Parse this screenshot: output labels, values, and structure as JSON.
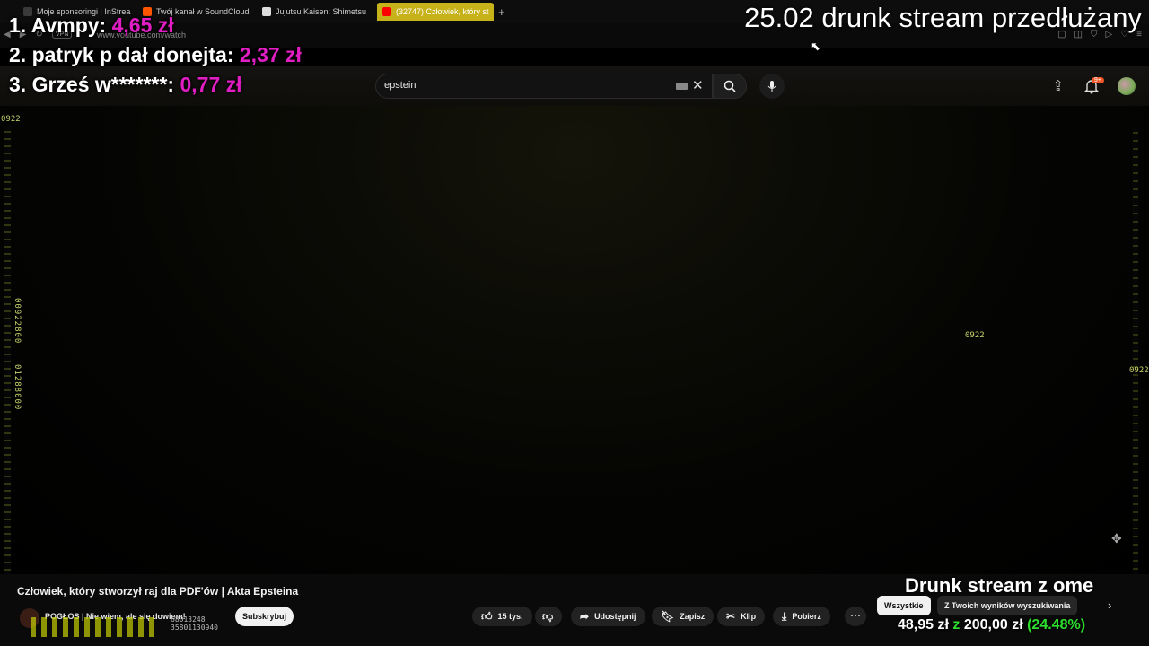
{
  "browser": {
    "tabs": [
      {
        "label": "Moje sponsoringi | InStrea",
        "fav_color": "#3a3a3a",
        "active": false
      },
      {
        "label": "Twój kanał w SoundCloud",
        "fav_color": "#ff5500",
        "active": false
      },
      {
        "label": "Jujutsu Kaisen: Shimetsu",
        "fav_color": "#dddddd",
        "active": false
      },
      {
        "label": "(32747) Człowiek, który st",
        "fav_color": "#ff0000",
        "active": true
      }
    ],
    "new_tab_label": "+",
    "vpn_label": "VPN",
    "url": "www.youtube.com/watch"
  },
  "overlay": {
    "stream_title": "25.02 drunk stream przedłużany",
    "donors": [
      {
        "label": "1. Avmpy: ",
        "amount": "4,65 zł"
      },
      {
        "label": "2. patryk p dał donejta: ",
        "amount": "2,37 zł"
      },
      {
        "label": "3. Grześ w*******: ",
        "amount": "0,77 zł"
      }
    ],
    "goal": {
      "title": "Drunk stream z ome",
      "current": "48,95 zł",
      "separator": " z ",
      "target": "200,00 zł",
      "percent": " (24.48%)",
      "fraction": 0.2448
    }
  },
  "youtube": {
    "search_value": "epstein",
    "notif_count": "9+",
    "video": {
      "title": "Człowiek, który stworzył raj dla PDF'ów | Akta Epsteina",
      "channel": "POGŁOS | Nie wiem, ale się dowiem!",
      "subscribe_label": "Subskrybuj",
      "likes": "15 tys.",
      "share_label": "Udostępnij",
      "save_label": "Zapisz",
      "clip_label": "Klip",
      "download_label": "Pobierz",
      "glitch_numbers": [
        "68013248",
        "35801130940"
      ]
    },
    "chips": {
      "all_label": "Wszystkie",
      "search_results_label": "Z Twoich wyników wyszukiwania"
    }
  },
  "glitch_text": {
    "top_left": "0922",
    "mid_right": "0922",
    "far_right": "0922",
    "vertical_a": "00922800",
    "vertical_b": "01288000"
  },
  "colors": {
    "donation_amount": "#e01ec3",
    "goal_accent": "#2de02d",
    "active_tab": "#c7b21a"
  }
}
